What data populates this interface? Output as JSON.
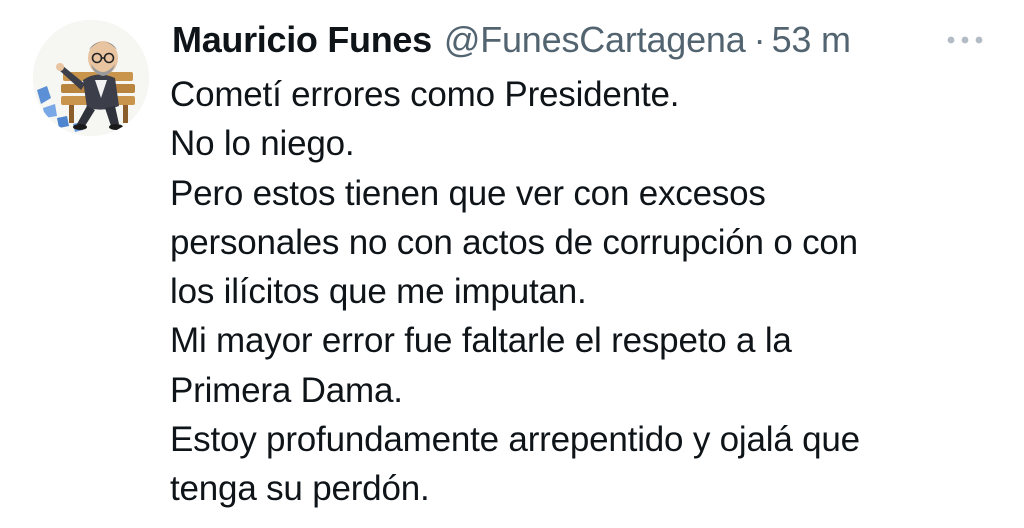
{
  "tweet": {
    "author": {
      "display_name": "Mauricio Funes",
      "handle": "@FunesCartagena",
      "avatar_icon": "caricature-avatar"
    },
    "separator": "·",
    "timestamp": "53 m",
    "more_icon": "more-options-icon",
    "lines": [
      "Cometí errores como Presidente.",
      "No lo niego.",
      "Pero estos tienen que ver con excesos",
      "personales no con actos de corrupción o con",
      "los ilícitos que me imputan.",
      "Mi mayor error fue faltarle el respeto a la",
      "Primera Dama.",
      "Estoy profundamente arrepentido y ojalá que",
      "tenga su perdón."
    ]
  },
  "colors": {
    "text_primary": "#0f1419",
    "text_secondary": "#536471",
    "background": "#ffffff"
  }
}
